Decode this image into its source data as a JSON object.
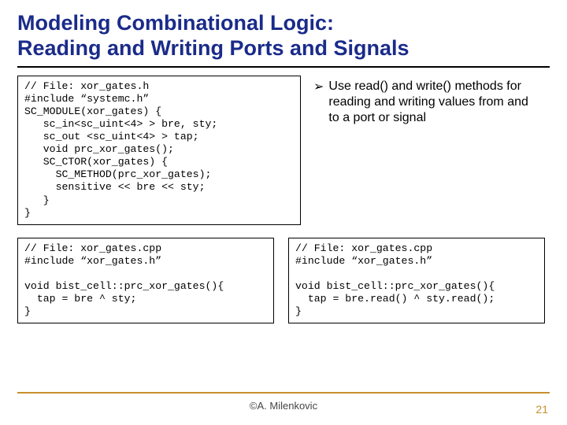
{
  "title_line1": "Modeling Combinational Logic:",
  "title_line2": "Reading and Writing Ports and Signals",
  "code_top": "// File: xor_gates.h\n#include “systemc.h”\nSC_MODULE(xor_gates) {\n   sc_in<sc_uint<4> > bre, sty;\n   sc_out <sc_uint<4> > tap;\n   void prc_xor_gates();\n   SC_CTOR(xor_gates) {\n     SC_METHOD(prc_xor_gates);\n     sensitive << bre << sty;\n   }\n}",
  "bullet_marker": "➢",
  "bullet_text": "Use read() and write() methods for reading and writing values from and to a port or signal",
  "code_bl": "// File: xor_gates.cpp\n#include “xor_gates.h”\n\nvoid bist_cell::prc_xor_gates(){\n  tap = bre ^ sty;\n}",
  "code_br": "// File: xor_gates.cpp\n#include “xor_gates.h”\n\nvoid bist_cell::prc_xor_gates(){\n  tap = bre.read() ^ sty.read();\n}",
  "author": "©A. Milenkovic",
  "page_number": "21"
}
